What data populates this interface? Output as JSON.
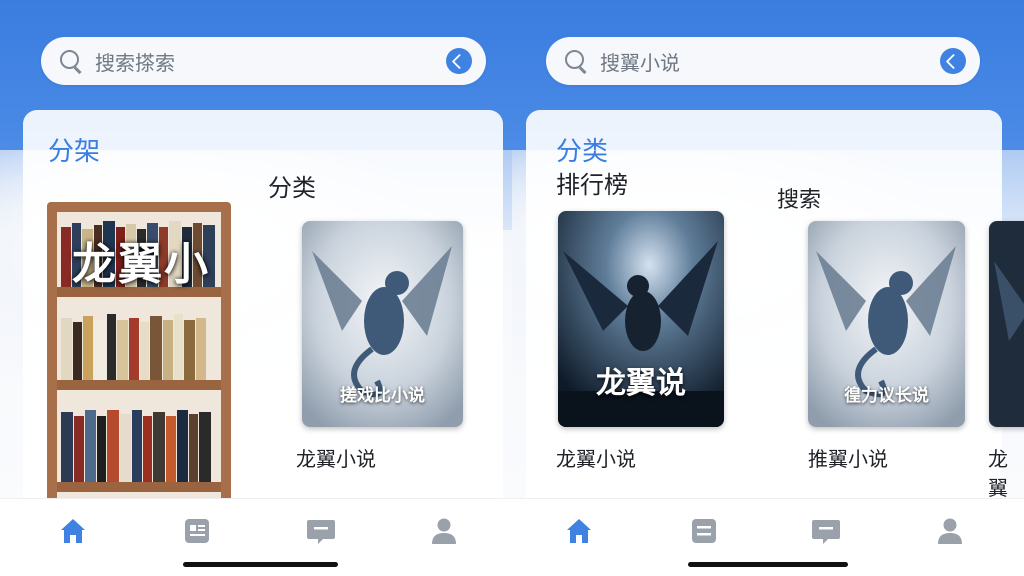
{
  "colors": {
    "accent": "#3a7ee0",
    "tab_active": "#3f82e2",
    "tab_inactive": "#9aa1aa"
  },
  "left": {
    "search": {
      "placeholder": "搜索搽索",
      "icon": "search-icon",
      "action_icon": "arrow-go-icon"
    },
    "card_title": "分架",
    "section_label": "分类",
    "shelf_text": "龙翼小",
    "book": {
      "cover_title": "搓戏比小说",
      "caption": "龙翼小说"
    }
  },
  "right": {
    "search": {
      "placeholder": "搜翼小说",
      "icon": "search-icon",
      "action_icon": "arrow-go-icon"
    },
    "card_title": "分类",
    "ranking_label": "排行榜",
    "search_label": "搜索",
    "books": [
      {
        "cover_title": "龙翼说",
        "caption": "龙翼小说"
      },
      {
        "cover_title": "徨力议长说",
        "caption": "推翼小说"
      },
      {
        "cover_title": "",
        "caption": "龙翼"
      }
    ]
  },
  "tabbar": {
    "items": [
      {
        "icon": "home-icon",
        "active": true
      },
      {
        "icon": "list-icon",
        "active": false
      },
      {
        "icon": "message-icon",
        "active": false
      },
      {
        "icon": "user-icon",
        "active": false
      }
    ]
  }
}
